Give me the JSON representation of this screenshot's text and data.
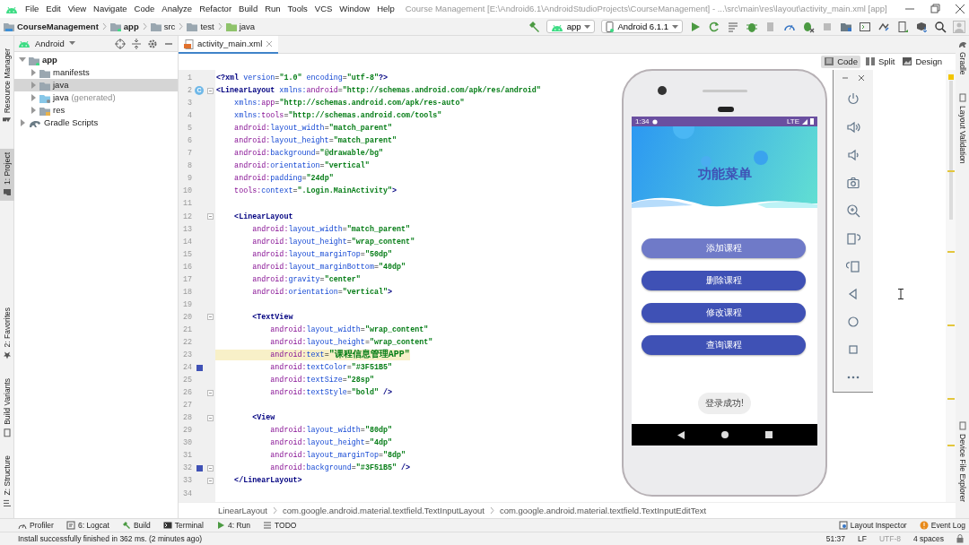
{
  "menubar": {
    "menus": [
      "File",
      "Edit",
      "View",
      "Navigate",
      "Code",
      "Analyze",
      "Refactor",
      "Build",
      "Run",
      "Tools",
      "VCS",
      "Window",
      "Help"
    ],
    "title": "Course Management [E:\\Android6.1\\AndroidStudioProjects\\CourseManagement] - ...\\src\\main\\res\\layout\\activity_main.xml [app]"
  },
  "breadcrumb": [
    {
      "label": "CourseManagement",
      "kind": "project"
    },
    {
      "label": "app",
      "kind": "module"
    },
    {
      "label": "src",
      "kind": "folder"
    },
    {
      "label": "test",
      "kind": "folder"
    },
    {
      "label": "java",
      "kind": "source"
    }
  ],
  "toolbar": {
    "config": "app",
    "device": "Android 6.1.1"
  },
  "left_tabs": [
    {
      "label": "Resource Manager",
      "selected": false
    },
    {
      "label": "1: Project",
      "selected": true
    },
    {
      "label": "2: Favorites",
      "selected": false
    },
    {
      "label": "Build Variants",
      "selected": false
    },
    {
      "label": "Z: Structure",
      "selected": false
    }
  ],
  "project": {
    "view": "Android",
    "tree": [
      {
        "label": "app",
        "kind": "module",
        "expanded": true,
        "selected": false,
        "children": [
          {
            "label": "manifests",
            "kind": "folder",
            "expanded": false,
            "selected": false
          },
          {
            "label": "java",
            "kind": "folder",
            "expanded": false,
            "selected": true
          },
          {
            "label": "java",
            "note": "(generated)",
            "kind": "generated",
            "expanded": false,
            "selected": false
          },
          {
            "label": "res",
            "kind": "res",
            "expanded": false,
            "selected": false
          }
        ]
      },
      {
        "label": "Gradle Scripts",
        "kind": "gradle",
        "expanded": false,
        "selected": false
      }
    ]
  },
  "editor": {
    "tabs": [
      {
        "label": "activity_main.xml",
        "selected": true
      }
    ],
    "view_modes": [
      {
        "label": "Code",
        "selected": true
      },
      {
        "label": "Split",
        "selected": false
      },
      {
        "label": "Design",
        "selected": false
      }
    ],
    "lines": [
      {
        "n": "1",
        "fold": false,
        "t": [
          {
            "kind": "tag",
            "text": "<?xml"
          },
          {
            "kind": "attr",
            "text": " version"
          },
          {
            "kind": "eq",
            "text": "="
          },
          {
            "kind": "val",
            "text": "\"1.0\""
          },
          {
            "kind": "attr",
            "text": " encoding"
          },
          {
            "kind": "eq",
            "text": "="
          },
          {
            "kind": "val",
            "text": "\"utf-8\""
          },
          {
            "kind": "tag",
            "text": "?>"
          }
        ]
      },
      {
        "n": "2",
        "fold": true,
        "badge": "C",
        "t": [
          {
            "kind": "tag",
            "text": "<LinearLayout"
          },
          {
            "kind": "attr",
            "text": " xmlns:"
          },
          {
            "kind": "ns",
            "text": "android"
          },
          {
            "kind": "eq",
            "text": "="
          },
          {
            "kind": "val",
            "text": "\"http://schemas.android.com/apk/res/android\""
          }
        ]
      },
      {
        "n": "3",
        "fold": false,
        "t": [
          {
            "kind": "attr",
            "text": "    xmlns:"
          },
          {
            "kind": "ns",
            "text": "app"
          },
          {
            "kind": "eq",
            "text": "="
          },
          {
            "kind": "val",
            "text": "\"http://schemas.android.com/apk/res-auto\""
          }
        ]
      },
      {
        "n": "4",
        "fold": false,
        "t": [
          {
            "kind": "attr",
            "text": "    xmlns:"
          },
          {
            "kind": "ns",
            "text": "tools"
          },
          {
            "kind": "eq",
            "text": "="
          },
          {
            "kind": "val",
            "text": "\"http://schemas.android.com/tools\""
          }
        ]
      },
      {
        "n": "5",
        "fold": false,
        "t": [
          {
            "kind": "ns",
            "text": "    android:"
          },
          {
            "kind": "attr",
            "text": "layout_width"
          },
          {
            "kind": "eq",
            "text": "="
          },
          {
            "kind": "val",
            "text": "\"match_parent\""
          }
        ]
      },
      {
        "n": "6",
        "fold": false,
        "t": [
          {
            "kind": "ns",
            "text": "    android:"
          },
          {
            "kind": "attr",
            "text": "layout_height"
          },
          {
            "kind": "eq",
            "text": "="
          },
          {
            "kind": "val",
            "text": "\"match_parent\""
          }
        ]
      },
      {
        "n": "7",
        "fold": false,
        "t": [
          {
            "kind": "ns",
            "text": "    android:"
          },
          {
            "kind": "attr",
            "text": "background"
          },
          {
            "kind": "eq",
            "text": "="
          },
          {
            "kind": "val",
            "text": "\"@drawable/bg\""
          }
        ]
      },
      {
        "n": "8",
        "fold": false,
        "t": [
          {
            "kind": "ns",
            "text": "    android:"
          },
          {
            "kind": "attr",
            "text": "orientation"
          },
          {
            "kind": "eq",
            "text": "="
          },
          {
            "kind": "val",
            "text": "\"vertical\""
          }
        ]
      },
      {
        "n": "9",
        "fold": false,
        "t": [
          {
            "kind": "ns",
            "text": "    android:"
          },
          {
            "kind": "attr",
            "text": "padding"
          },
          {
            "kind": "eq",
            "text": "="
          },
          {
            "kind": "val",
            "text": "\"24dp\""
          }
        ]
      },
      {
        "n": "10",
        "fold": false,
        "t": [
          {
            "kind": "ns",
            "text": "    tools:"
          },
          {
            "kind": "attr",
            "text": "context"
          },
          {
            "kind": "eq",
            "text": "="
          },
          {
            "kind": "val",
            "text": "\".Login.MainActivity\""
          },
          {
            "kind": "tag",
            "text": ">"
          }
        ]
      },
      {
        "n": "11",
        "fold": false
      },
      {
        "n": "12",
        "fold": true,
        "t": [
          {
            "kind": "tag",
            "text": "    <LinearLayout"
          }
        ]
      },
      {
        "n": "13",
        "fold": false,
        "t": [
          {
            "kind": "ns",
            "text": "        android:"
          },
          {
            "kind": "attr",
            "text": "layout_width"
          },
          {
            "kind": "eq",
            "text": "="
          },
          {
            "kind": "val",
            "text": "\"match_parent\""
          }
        ]
      },
      {
        "n": "14",
        "fold": false,
        "t": [
          {
            "kind": "ns",
            "text": "        android:"
          },
          {
            "kind": "attr",
            "text": "layout_height"
          },
          {
            "kind": "eq",
            "text": "="
          },
          {
            "kind": "val",
            "text": "\"wrap_content\""
          }
        ]
      },
      {
        "n": "15",
        "fold": false,
        "t": [
          {
            "kind": "ns",
            "text": "        android:"
          },
          {
            "kind": "attr",
            "text": "layout_marginTop"
          },
          {
            "kind": "eq",
            "text": "="
          },
          {
            "kind": "val",
            "text": "\"50dp\""
          }
        ]
      },
      {
        "n": "16",
        "fold": false,
        "t": [
          {
            "kind": "ns",
            "text": "        android:"
          },
          {
            "kind": "attr",
            "text": "layout_marginBottom"
          },
          {
            "kind": "eq",
            "text": "="
          },
          {
            "kind": "val",
            "text": "\"40dp\""
          }
        ]
      },
      {
        "n": "17",
        "fold": false,
        "t": [
          {
            "kind": "ns",
            "text": "        android:"
          },
          {
            "kind": "attr",
            "text": "gravity"
          },
          {
            "kind": "eq",
            "text": "="
          },
          {
            "kind": "val",
            "text": "\"center\""
          }
        ]
      },
      {
        "n": "18",
        "fold": false,
        "t": [
          {
            "kind": "ns",
            "text": "        android:"
          },
          {
            "kind": "attr",
            "text": "orientation"
          },
          {
            "kind": "eq",
            "text": "="
          },
          {
            "kind": "val",
            "text": "\"vertical\""
          },
          {
            "kind": "tag",
            "text": ">"
          }
        ]
      },
      {
        "n": "19",
        "fold": false
      },
      {
        "n": "20",
        "fold": true,
        "t": [
          {
            "kind": "tag",
            "text": "        <TextView"
          }
        ]
      },
      {
        "n": "21",
        "fold": false,
        "t": [
          {
            "kind": "ns",
            "text": "            android:"
          },
          {
            "kind": "attr",
            "text": "layout_width"
          },
          {
            "kind": "eq",
            "text": "="
          },
          {
            "kind": "val",
            "text": "\"wrap_content\""
          }
        ]
      },
      {
        "n": "22",
        "fold": false,
        "t": [
          {
            "kind": "ns",
            "text": "            android:"
          },
          {
            "kind": "attr",
            "text": "layout_height"
          },
          {
            "kind": "eq",
            "text": "="
          },
          {
            "kind": "val",
            "text": "\"wrap_content\""
          }
        ]
      },
      {
        "n": "23",
        "fold": false,
        "highlighted": true,
        "t": [
          {
            "kind": "ns",
            "text": "            android:"
          },
          {
            "kind": "attr",
            "text": "text"
          },
          {
            "kind": "eq",
            "text": "="
          },
          {
            "kind": "val",
            "text": "\"课程信息管理APP\""
          }
        ]
      },
      {
        "n": "24",
        "fold": false,
        "color": "#3f51b5",
        "t": [
          {
            "kind": "ns",
            "text": "            android:"
          },
          {
            "kind": "attr",
            "text": "textColor"
          },
          {
            "kind": "eq",
            "text": "="
          },
          {
            "kind": "val",
            "text": "\"#3F51B5\""
          }
        ]
      },
      {
        "n": "25",
        "fold": false,
        "t": [
          {
            "kind": "ns",
            "text": "            android:"
          },
          {
            "kind": "attr",
            "text": "textSize"
          },
          {
            "kind": "eq",
            "text": "="
          },
          {
            "kind": "val",
            "text": "\"28sp\""
          }
        ]
      },
      {
        "n": "26",
        "fold": true,
        "t": [
          {
            "kind": "ns",
            "text": "            android:"
          },
          {
            "kind": "attr",
            "text": "textStyle"
          },
          {
            "kind": "eq",
            "text": "="
          },
          {
            "kind": "val",
            "text": "\"bold\""
          },
          {
            "kind": "tag",
            "text": " />"
          }
        ]
      },
      {
        "n": "27",
        "fold": false
      },
      {
        "n": "28",
        "fold": true,
        "t": [
          {
            "kind": "tag",
            "text": "        <View"
          }
        ]
      },
      {
        "n": "29",
        "fold": false,
        "t": [
          {
            "kind": "ns",
            "text": "            android:"
          },
          {
            "kind": "attr",
            "text": "layout_width"
          },
          {
            "kind": "eq",
            "text": "="
          },
          {
            "kind": "val",
            "text": "\"80dp\""
          }
        ]
      },
      {
        "n": "30",
        "fold": false,
        "t": [
          {
            "kind": "ns",
            "text": "            android:"
          },
          {
            "kind": "attr",
            "text": "layout_height"
          },
          {
            "kind": "eq",
            "text": "="
          },
          {
            "kind": "val",
            "text": "\"4dp\""
          }
        ]
      },
      {
        "n": "31",
        "fold": false,
        "t": [
          {
            "kind": "ns",
            "text": "            android:"
          },
          {
            "kind": "attr",
            "text": "layout_marginTop"
          },
          {
            "kind": "eq",
            "text": "="
          },
          {
            "kind": "val",
            "text": "\"8dp\""
          }
        ]
      },
      {
        "n": "32",
        "fold": true,
        "color": "#3f51b5",
        "t": [
          {
            "kind": "ns",
            "text": "            android:"
          },
          {
            "kind": "attr",
            "text": "background"
          },
          {
            "kind": "eq",
            "text": "="
          },
          {
            "kind": "val",
            "text": "\"#3F51B5\""
          },
          {
            "kind": "tag",
            "text": " />"
          }
        ]
      },
      {
        "n": "33",
        "fold": true,
        "t": [
          {
            "kind": "tag",
            "text": "    </LinearLayout>"
          }
        ]
      },
      {
        "n": "34",
        "fold": false
      }
    ],
    "breadcrumb": [
      "LinearLayout",
      "com.google.android.material.textfield.TextInputLayout",
      "com.google.android.material.textfield.TextInputEditText"
    ]
  },
  "emulator": {
    "time": "1:34",
    "network": "LTE",
    "title": "功能菜单",
    "buttons": [
      {
        "label": "添加课程",
        "pressed": true
      },
      {
        "label": "删除课程",
        "pressed": false
      },
      {
        "label": "修改课程",
        "pressed": false
      },
      {
        "label": "查询课程",
        "pressed": false
      }
    ],
    "toast": "登录成功!"
  },
  "right_tabs": [
    {
      "label": "Gradle",
      "selected": false
    },
    {
      "label": "Layout Validation",
      "selected": false
    },
    {
      "label": "Device File Explorer",
      "selected": false
    }
  ],
  "bottom_tabs": [
    "Profiler",
    "6: Logcat",
    "Build",
    "Terminal",
    "4: Run",
    "TODO"
  ],
  "bottom_right_tabs": [
    "Layout Inspector",
    "Event Log"
  ],
  "status_bar": {
    "message": "Install successfully finished in 362 ms. (2 minutes ago)",
    "position": "51:37",
    "line_separator": "LF",
    "encoding": "UTF-8",
    "indent": "4 spaces"
  }
}
